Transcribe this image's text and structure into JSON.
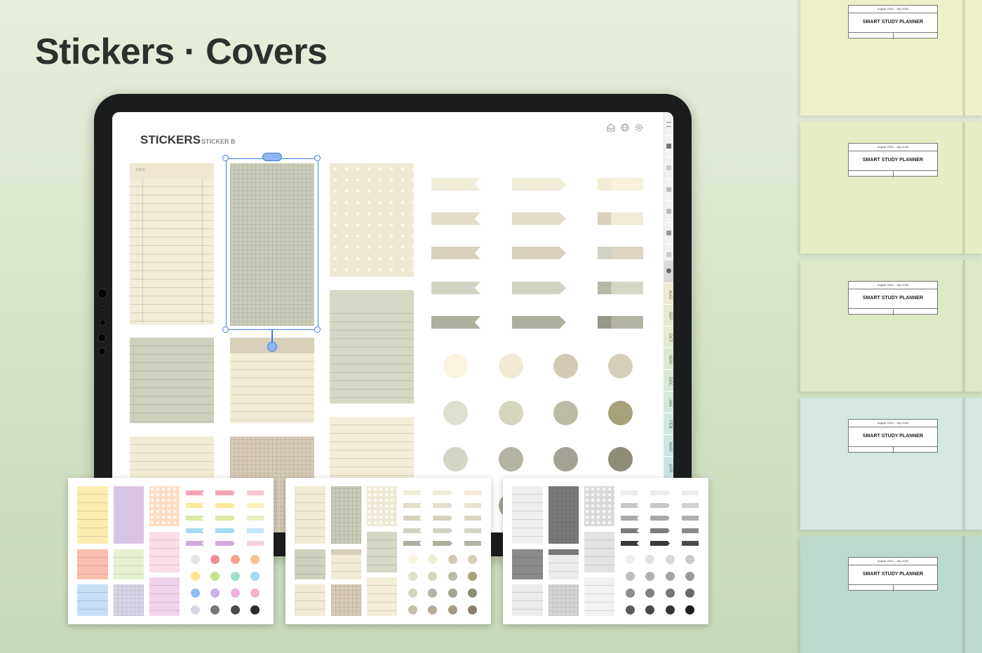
{
  "headline": "Stickers · Covers",
  "screen": {
    "title": "STICKERS",
    "subtitle": "STICKER B",
    "header_icons": [
      "inbox-icon",
      "globe-icon",
      "settings-icon"
    ],
    "side_tabs": [
      "AUG",
      "SEP",
      "OCT",
      "NOV",
      "DEC",
      "JAN",
      "FEB",
      "MAR",
      "APR"
    ],
    "paper_label": "DATE"
  },
  "previews": [
    {
      "theme": "pastel"
    },
    {
      "theme": "neutral"
    },
    {
      "theme": "grayscale"
    }
  ],
  "covers": [
    {
      "date": "August 2025 – July 2026",
      "title": "SMART STUDY PLANNER",
      "color": "#eef0c8"
    },
    {
      "date": "August 2025 – July 2026",
      "title": "SMART STUDY PLANNER",
      "color": "#e6edc4"
    },
    {
      "date": "August 2025 – July 2026",
      "title": "SMART STUDY PLANNER",
      "color": "#dde8c6"
    },
    {
      "date": "August 2025 – July 2026",
      "title": "SMART STUDY PLANNER",
      "color": "#d4e7e3"
    },
    {
      "date": "August 2025 – July 2026",
      "title": "SMART STUDY PLANNER",
      "color": "#bcd9cd"
    }
  ]
}
